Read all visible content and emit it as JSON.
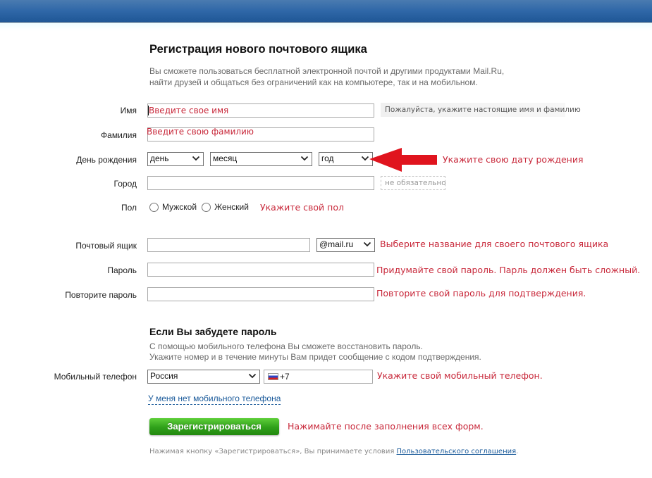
{
  "header": {
    "brand_color": "#2f67a8"
  },
  "page": {
    "title": "Регистрация нового почтового ящика",
    "subtitle_lines": [
      "Вы сможете пользоваться бесплатной электронной почтой и другими продуктами Mail.Ru,",
      "найти друзей и общаться без ограничений как на компьютере, так и на мобильном."
    ]
  },
  "form": {
    "first_name": {
      "label": "Имя",
      "value": "Введите свое имя",
      "hint": "Пожалуйста, укажите настоящие имя и фамилию"
    },
    "last_name": {
      "label": "Фамилия",
      "value": "Введите свою фамилию"
    },
    "birthday": {
      "label": "День рождения",
      "day": "день",
      "month": "месяц",
      "year": "год",
      "note": "Укажите свою дату рождения"
    },
    "city": {
      "label": "Город",
      "value": "",
      "hint": "не обязательно"
    },
    "gender": {
      "label": "Пол",
      "options": [
        "Мужской",
        "Женский"
      ],
      "note": "Укажите свой пол"
    },
    "mailbox": {
      "label": "Почтовый ящик",
      "value": "",
      "domain": "@mail.ru",
      "note": "Выберите название для своего почтового ящика"
    },
    "password": {
      "label": "Пароль",
      "value": "",
      "note": "Придумайте свой пароль. Парль должен быть сложный."
    },
    "password_repeat": {
      "label": "Повторите пароль",
      "value": "",
      "note": "Повторите свой пароль для подтверждения."
    }
  },
  "recovery": {
    "title": "Если Вы забудете пароль",
    "subtitle_lines": [
      "С помощью мобильного телефона Вы сможете восстановить пароль.",
      "Укажите номер и в течение минуты Вам придет сообщение с кодом подтверждения."
    ],
    "phone": {
      "label": "Мобильный телефон",
      "country": "Россия",
      "flag_icon": "russia-flag-icon",
      "code": "+7",
      "note": "Укажите свой мобильный телефон."
    },
    "no_phone_link": "У меня нет мобильного телефона"
  },
  "submit": {
    "label": "Зарегистрироваться",
    "note": "Нажимайте после заполнения всех форм.",
    "terms_text": "Нажимая кнопку «Зарегистрироваться», Вы принимаете условия ",
    "terms_link": "Пользовательского соглашения",
    "terms_end": "."
  },
  "colors": {
    "annotation_red": "#c8283a",
    "arrow_red": "#e0141e",
    "button_green": "#2fa01a",
    "link_blue": "#1a5a9a"
  }
}
